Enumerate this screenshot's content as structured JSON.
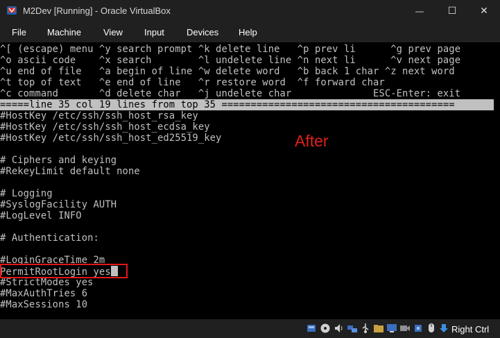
{
  "window": {
    "title": "M2Dev [Running] - Oracle VirtualBox",
    "controls": {
      "minimize": "—",
      "maximize": "☐",
      "close": "✕"
    }
  },
  "menu": [
    "File",
    "Machine",
    "View",
    "Input",
    "Devices",
    "Help"
  ],
  "help_lines": [
    "^[ (escape) menu ^y search prompt ^k delete line   ^p prev li      ^g prev page",
    "^o ascii code    ^x search        ^l undelete line ^n next li      ^v next page",
    "^u end of file   ^a begin of line ^w delete word   ^b back 1 char ^z next word",
    "^t top of text   ^e end of line   ^r restore word  ^f forward char",
    "^c command       ^d delete char   ^j undelete char              ESC-Enter: exit"
  ],
  "status_line": "=====line 35 col 19 lines from top 35 ========================================",
  "file_lines": [
    "#HostKey /etc/ssh/ssh_host_rsa_key",
    "#HostKey /etc/ssh/ssh_host_ecdsa_key",
    "#HostKey /etc/ssh/ssh_host_ed25519_key",
    "",
    "# Ciphers and keying",
    "#RekeyLimit default none",
    "",
    "# Logging",
    "#SyslogFacility AUTH",
    "#LogLevel INFO",
    "",
    "# Authentication:",
    "",
    "#LoginGraceTime 2m",
    "PermitRootLogin yes",
    "#StrictModes yes",
    "#MaxAuthTries 6",
    "#MaxSessions 10"
  ],
  "annotation": "After",
  "host_key": "Right Ctrl",
  "status_icons": [
    "disk-icon",
    "optical-icon",
    "audio-icon",
    "network-icon",
    "usb-icon",
    "shared-folder-icon",
    "display-icon",
    "video-capture-icon",
    "cpu-icon",
    "mouse-integration-icon",
    "host-key-icon"
  ],
  "colors": {
    "highlight": "#e0181a",
    "annotation": "#e0201e",
    "terminal_fg": "#c0c0c0",
    "terminal_bg": "#000000"
  }
}
